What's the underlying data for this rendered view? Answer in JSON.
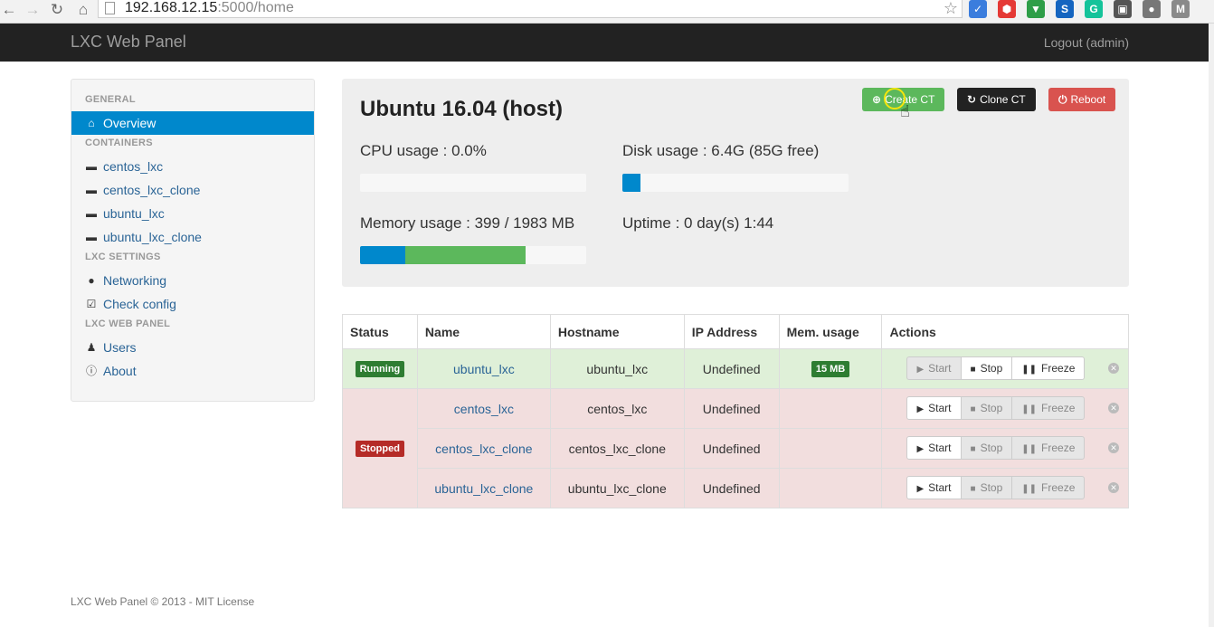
{
  "browser": {
    "url_host": "192.168.12.15",
    "url_path": ":5000/home",
    "extensions": [
      {
        "name": "bookmark-ext-icon",
        "color": "#3b7ddd",
        "glyph": "✓"
      },
      {
        "name": "adblock-ext-icon",
        "color": "#e53935",
        "glyph": "⬢"
      },
      {
        "name": "shield-ext-icon",
        "color": "#2e9e48",
        "glyph": "▼"
      },
      {
        "name": "skype-ext-icon",
        "color": "#1565c0",
        "glyph": "S"
      },
      {
        "name": "grammarly-ext-icon",
        "color": "#15c39a",
        "glyph": "G"
      },
      {
        "name": "camera-ext-icon",
        "color": "#555555",
        "glyph": "▣"
      },
      {
        "name": "globe-ext-icon",
        "color": "#777777",
        "glyph": "●"
      },
      {
        "name": "mail-ext-icon",
        "color": "#8a8a8a",
        "glyph": "M"
      }
    ]
  },
  "navbar": {
    "brand": "LXC Web Panel",
    "logout": "Logout (admin)"
  },
  "sidebar": {
    "sections": [
      {
        "header": "GENERAL",
        "items": [
          {
            "label": "Overview",
            "icon": "home-icon",
            "active": true
          }
        ]
      },
      {
        "header": "CONTAINERS",
        "items": [
          {
            "label": "centos_lxc",
            "icon": "hdd-icon"
          },
          {
            "label": "centos_lxc_clone",
            "icon": "hdd-icon"
          },
          {
            "label": "ubuntu_lxc",
            "icon": "hdd-icon"
          },
          {
            "label": "ubuntu_lxc_clone",
            "icon": "hdd-icon"
          }
        ]
      },
      {
        "header": "LXC SETTINGS",
        "items": [
          {
            "label": "Networking",
            "icon": "globe-icon"
          },
          {
            "label": "Check config",
            "icon": "check-icon"
          }
        ]
      },
      {
        "header": "LXC WEB PANEL",
        "items": [
          {
            "label": "Users",
            "icon": "user-icon"
          },
          {
            "label": "About",
            "icon": "info-icon"
          }
        ]
      }
    ]
  },
  "host": {
    "title": "Ubuntu 16.04 (host)",
    "cpu_label": "CPU usage : 0.0%",
    "cpu_fraction": 0.0,
    "disk_label": "Disk usage : 6.4G (85G free)",
    "disk_fraction": 0.08,
    "memory_label": "Memory usage : 399 / 1983 MB",
    "memory_used_fraction": 0.2,
    "memory_cached_fraction": 0.53,
    "uptime_label": "Uptime : 0 day(s) 1:44",
    "buttons": {
      "create": "Create CT",
      "clone": "Clone CT",
      "reboot": "Reboot"
    },
    "colors": {
      "create": "#5cb85c",
      "clone": "#222222",
      "reboot": "#d9534f",
      "bar_primary": "#0088cc",
      "bar_success": "#5cb85c"
    }
  },
  "table": {
    "headers": [
      "Status",
      "Name",
      "Hostname",
      "IP Address",
      "Mem. usage",
      "Actions"
    ],
    "status_running": "Running",
    "status_stopped": "Stopped",
    "actions": {
      "start": "Start",
      "stop": "Stop",
      "freeze": "Freeze"
    },
    "rows": [
      {
        "name": "ubuntu_lxc",
        "hostname": "ubuntu_lxc",
        "ip": "Undefined",
        "mem": "15 MB",
        "state": "running"
      },
      {
        "name": "centos_lxc",
        "hostname": "centos_lxc",
        "ip": "Undefined",
        "mem": "",
        "state": "stopped"
      },
      {
        "name": "centos_lxc_clone",
        "hostname": "centos_lxc_clone",
        "ip": "Undefined",
        "mem": "",
        "state": "stopped"
      },
      {
        "name": "ubuntu_lxc_clone",
        "hostname": "ubuntu_lxc_clone",
        "ip": "Undefined",
        "mem": "",
        "state": "stopped"
      }
    ]
  },
  "footer": "LXC Web Panel © 2013 - MIT License"
}
